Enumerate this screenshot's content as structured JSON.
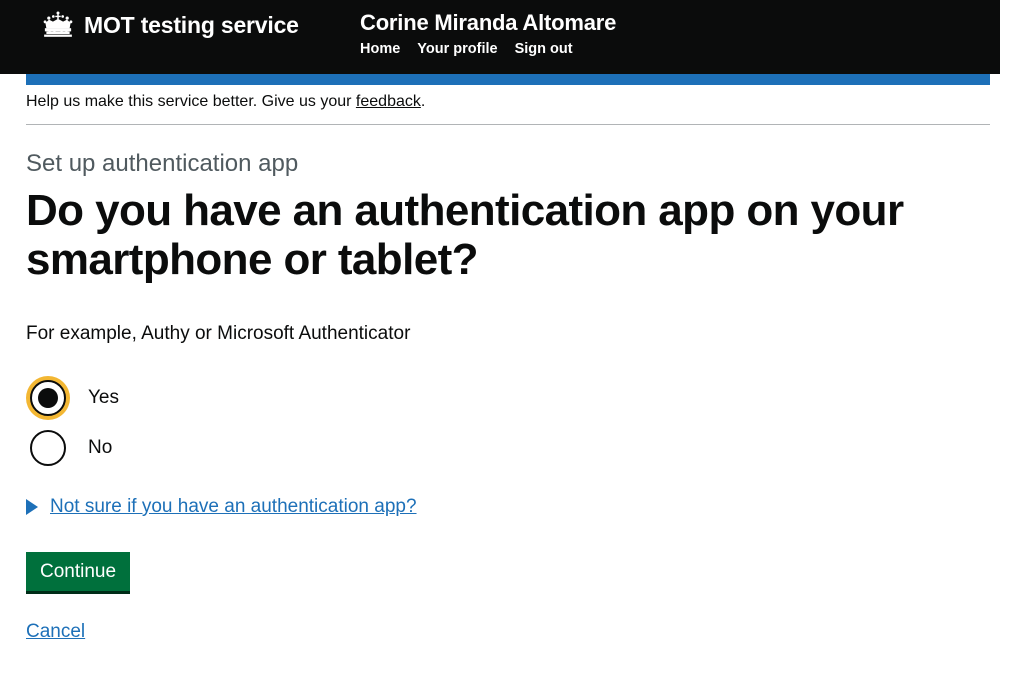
{
  "header": {
    "crown_icon": "crown-icon",
    "service_name": "MOT testing service",
    "user_name": "Corine Miranda Altomare",
    "nav": [
      {
        "label": "Home"
      },
      {
        "label": "Your profile"
      },
      {
        "label": "Sign out"
      }
    ]
  },
  "feedback": {
    "text_before": "Help us make this service better. Give us your ",
    "link_label": "feedback",
    "text_after": "."
  },
  "main": {
    "caption": "Set up authentication app",
    "heading": "Do you have an authentication app on your smartphone or tablet?",
    "hint": "For example, Authy or Microsoft Authenticator",
    "radios": [
      {
        "label": "Yes",
        "selected": true,
        "focused": true
      },
      {
        "label": "No",
        "selected": false,
        "focused": false
      }
    ],
    "details_summary": "Not sure if you have an authentication app?",
    "continue_label": "Continue",
    "cancel_label": "Cancel"
  },
  "colors": {
    "header_background": "#0b0c0c",
    "strip_blue": "#1d70b8",
    "link_blue": "#1d70b8",
    "button_green": "#00703c",
    "focus_yellow": "#f3b733",
    "caption_grey": "#505a5f",
    "rule_grey": "#b1b4b6"
  }
}
